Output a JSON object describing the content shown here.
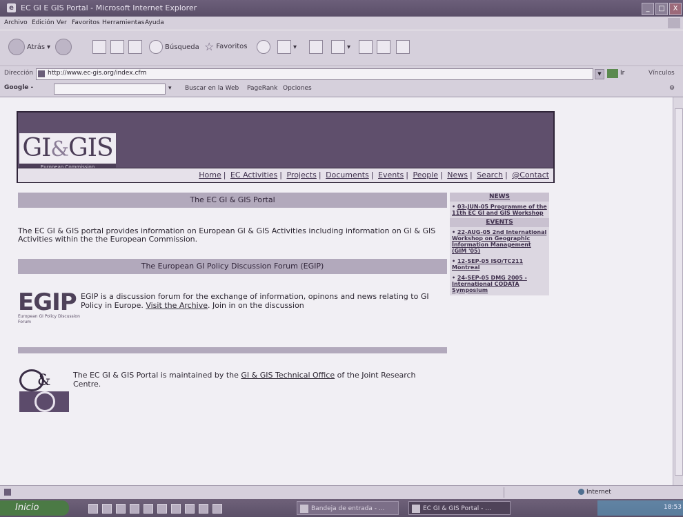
{
  "window": {
    "title": "EC GI E GIS Portal - Microsoft Internet Explorer",
    "controls": [
      "_",
      "□",
      "X"
    ]
  },
  "menu": [
    "Archivo",
    "Edición",
    "Ver",
    "Favoritos",
    "Herramientas",
    "Ayuda"
  ],
  "toolbar": {
    "back": "Atrás",
    "search": "Búsqueda",
    "favorites": "Favoritos"
  },
  "address": {
    "label": "Dirección",
    "url": "http://www.ec-gis.org/index.cfm",
    "go": "Ir",
    "links": "Vínculos"
  },
  "googlebar": {
    "label": "Google -",
    "search_web": "Buscar en la Web",
    "pagerank": "PageRank",
    "options": "Opciones"
  },
  "banner": {
    "logo_gi": "GI",
    "logo_amp": "&",
    "logo_gis": "GIS",
    "logo_sub": "European Commission",
    "nav": [
      "Home",
      "EC Activities",
      "Projects",
      "Documents",
      "Events",
      "People",
      "News",
      "Search",
      "@Contact"
    ]
  },
  "main": {
    "portal_title": "The EC GI & GIS Portal",
    "intro": "The EC GI & GIS portal provides information on European GI & GIS Activities including information on GI & GIS Activities within the the European Commission.",
    "forum_title": "The European GI Policy Discussion Forum (EGIP)",
    "egip_logo": "EGIP",
    "egip_logo_sub": "European GI Policy Discussion Forum",
    "egip_text_1": "EGIP is a discussion forum for the exchange of information, opinons and news relating to GI Policy in Europe.",
    "egip_link": "Visit the Archive",
    "egip_text_2": ". Join in on the discussion",
    "maint_1": "The EC GI & GIS Portal is maintained by the",
    "maint_link": "GI & GIS Technical Office",
    "maint_2": "of the Joint Research Centre."
  },
  "sidebar": {
    "news_title": "NEWS",
    "news": [
      "03-JUN-05 Programme of the 11th EC GI and GIS Workshop"
    ],
    "events_title": "EVENTS",
    "events": [
      "22-AUG-05 2nd International Workshop on Geographic Information Management (GIM '05)",
      "12-SEP-05 ISO/TC211 Montreal",
      "24-SEP-05 DMG 2005 - International CODATA Symposium"
    ]
  },
  "statusbar": {
    "zone": "Internet"
  },
  "taskbar": {
    "start": "Inicio",
    "tasks": [
      "Bandeja de entrada - ...",
      "EC GI & GIS Portal - ..."
    ],
    "time": "18:53"
  }
}
